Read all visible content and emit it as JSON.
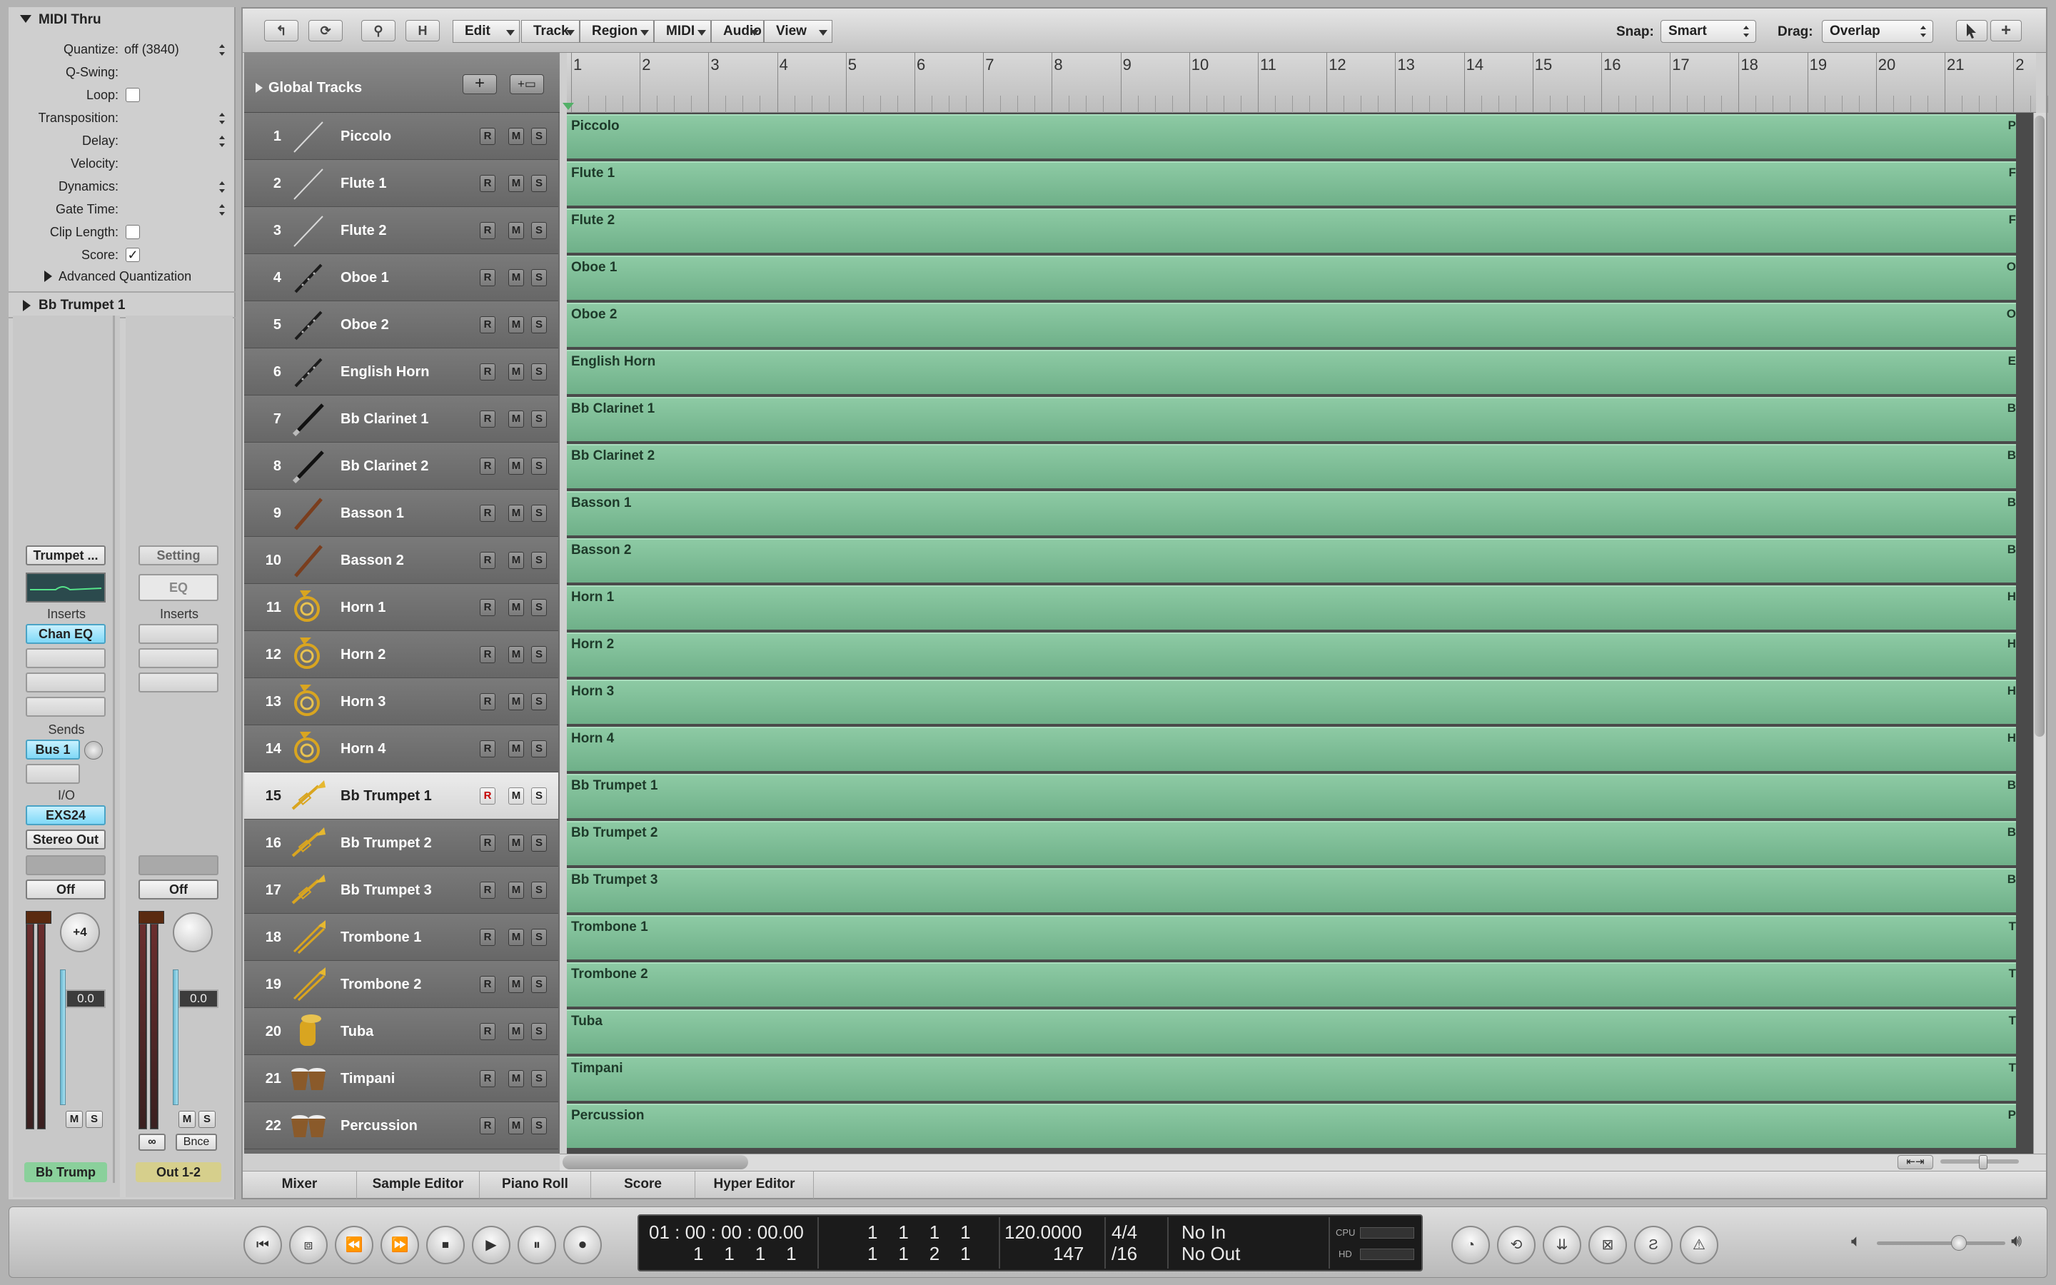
{
  "inspector": {
    "midi_thru_title": "MIDI Thru",
    "params": [
      {
        "label": "Quantize:",
        "value": "off (3840)",
        "control": "popup"
      },
      {
        "label": "Q-Swing:",
        "value": "",
        "control": "none"
      },
      {
        "label": "Loop:",
        "value": "",
        "control": "checkbox",
        "checked": false
      },
      {
        "label": "Transposition:",
        "value": "",
        "control": "popup"
      },
      {
        "label": "Delay:",
        "value": "",
        "control": "popup"
      },
      {
        "label": "Velocity:",
        "value": "",
        "control": "none"
      },
      {
        "label": "Dynamics:",
        "value": "",
        "control": "popup"
      },
      {
        "label": "Gate Time:",
        "value": "",
        "control": "popup"
      },
      {
        "label": "Clip Length:",
        "value": "",
        "control": "checkbox",
        "checked": false
      },
      {
        "label": "Score:",
        "value": "✓",
        "control": "checkbox",
        "checked": true
      }
    ],
    "advanced_quantization": "Advanced Quantization",
    "track_section_title": "Bb Trumpet 1"
  },
  "strip_left": {
    "setting": "Trumpet ...",
    "inserts_label": "Inserts",
    "insert_1": "Chan EQ",
    "sends_label": "Sends",
    "send_1": "Bus 1",
    "io_label": "I/O",
    "input": "EXS24",
    "output": "Stereo Out",
    "automation": "Off",
    "pan_value": "+4",
    "volume": "0.0",
    "mute": "M",
    "solo": "S",
    "name": "Bb Trump"
  },
  "strip_right": {
    "setting": "Setting",
    "eq": "EQ",
    "inserts_label": "Inserts",
    "automation": "Off",
    "volume": "0.0",
    "mute": "M",
    "solo": "S",
    "link": "∞",
    "bounce": "Bnce",
    "name": "Out 1-2"
  },
  "toolbar": {
    "menus": [
      "Edit",
      "Track",
      "Region",
      "MIDI",
      "Audio",
      "View"
    ],
    "icon_buttons": [
      "↰",
      "⟳",
      "⚲",
      "H"
    ],
    "snap_label": "Snap:",
    "snap_value": "Smart",
    "drag_label": "Drag:",
    "drag_value": "Overlap"
  },
  "global_tracks_label": "Global Tracks",
  "ruler_bars": [
    "1",
    "2",
    "3",
    "4",
    "5",
    "6",
    "7",
    "8",
    "9",
    "10",
    "11",
    "12",
    "13",
    "14",
    "15",
    "16",
    "17",
    "18",
    "19",
    "20",
    "21",
    "2"
  ],
  "track_buttons": {
    "record": "R",
    "mute": "M",
    "solo": "S"
  },
  "tracks": [
    {
      "num": "1",
      "name": "Piccolo",
      "icon": "woodwind-stick",
      "edge": "P"
    },
    {
      "num": "2",
      "name": "Flute 1",
      "icon": "woodwind-stick",
      "edge": "F"
    },
    {
      "num": "3",
      "name": "Flute 2",
      "icon": "woodwind-stick",
      "edge": "F"
    },
    {
      "num": "4",
      "name": "Oboe 1",
      "icon": "oboe",
      "edge": "O"
    },
    {
      "num": "5",
      "name": "Oboe 2",
      "icon": "oboe",
      "edge": "O"
    },
    {
      "num": "6",
      "name": "English Horn",
      "icon": "oboe",
      "edge": "E"
    },
    {
      "num": "7",
      "name": "Bb Clarinet 1",
      "icon": "clarinet",
      "edge": "B"
    },
    {
      "num": "8",
      "name": "Bb Clarinet 2",
      "icon": "clarinet",
      "edge": "B"
    },
    {
      "num": "9",
      "name": "Basson 1",
      "icon": "bassoon",
      "edge": "B"
    },
    {
      "num": "10",
      "name": "Basson 2",
      "icon": "bassoon",
      "edge": "B"
    },
    {
      "num": "11",
      "name": "Horn 1",
      "icon": "french-horn",
      "edge": "H"
    },
    {
      "num": "12",
      "name": "Horn 2",
      "icon": "french-horn",
      "edge": "H"
    },
    {
      "num": "13",
      "name": "Horn 3",
      "icon": "french-horn",
      "edge": "H"
    },
    {
      "num": "14",
      "name": "Horn 4",
      "icon": "french-horn",
      "edge": "H"
    },
    {
      "num": "15",
      "name": "Bb Trumpet 1",
      "icon": "trumpet",
      "edge": "B",
      "selected": true
    },
    {
      "num": "16",
      "name": "Bb Trumpet 2",
      "icon": "trumpet",
      "edge": "B"
    },
    {
      "num": "17",
      "name": "Bb Trumpet 3",
      "icon": "trumpet",
      "edge": "B"
    },
    {
      "num": "18",
      "name": "Trombone 1",
      "icon": "trombone",
      "edge": "T"
    },
    {
      "num": "19",
      "name": "Trombone 2",
      "icon": "trombone",
      "edge": "T"
    },
    {
      "num": "20",
      "name": "Tuba",
      "icon": "tuba",
      "edge": "T"
    },
    {
      "num": "21",
      "name": "Timpani",
      "icon": "timpani",
      "edge": "T"
    },
    {
      "num": "22",
      "name": "Percussion",
      "icon": "timpani",
      "edge": "P"
    }
  ],
  "bottom_tabs": [
    "Mixer",
    "Sample Editor",
    "Piano Roll",
    "Score",
    "Hyper Editor"
  ],
  "transport": {
    "smpte": "01 : 00 : 00 : 00.00",
    "smpte_sub": "1    1    1    1",
    "position": "1    1    1    1",
    "position_sub": "1    1    2    1",
    "tempo": "120.0000",
    "tempo_sub": "147",
    "signature": "4/4",
    "division": "/16",
    "midi_in": "No In",
    "midi_out": "No Out",
    "cpu_label": "CPU",
    "hd_label": "HD"
  },
  "colors": {
    "region_green": "#7dbd96",
    "track_header_gray": "#6f6f6f",
    "selected_track": "#e4e4e4",
    "blue_button": "#8fdcf6",
    "strip_name_green": "#8ad09b",
    "strip_name_yellow": "#d6cf8c"
  }
}
